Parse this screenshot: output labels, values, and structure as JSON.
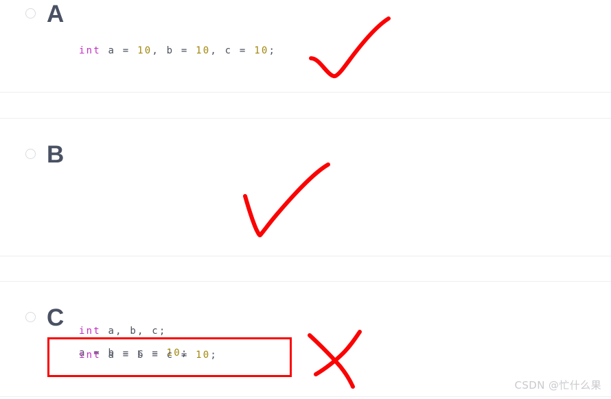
{
  "quiz": {
    "options": [
      {
        "letter": "A",
        "radio_state": "unselected",
        "code_lines": [
          [
            {
              "t": "int",
              "k": "kw"
            },
            {
              "t": " a ",
              "k": "id"
            },
            {
              "t": "=",
              "k": "op"
            },
            {
              "t": " ",
              "k": "punc"
            },
            {
              "t": "10",
              "k": "num"
            },
            {
              "t": ", b ",
              "k": "id"
            },
            {
              "t": "=",
              "k": "op"
            },
            {
              "t": " ",
              "k": "punc"
            },
            {
              "t": "10",
              "k": "num"
            },
            {
              "t": ", c ",
              "k": "id"
            },
            {
              "t": "=",
              "k": "op"
            },
            {
              "t": " ",
              "k": "punc"
            },
            {
              "t": "10",
              "k": "num"
            },
            {
              "t": ";",
              "k": "punc"
            }
          ]
        ],
        "code_text": "int a = 10, b = 10, c = 10;",
        "annotation": "check"
      },
      {
        "letter": "B",
        "radio_state": "unselected",
        "code_lines": [
          [
            {
              "t": "int",
              "k": "kw"
            },
            {
              "t": " a, b, c;",
              "k": "id"
            }
          ],
          [
            {
              "t": "a ",
              "k": "id"
            },
            {
              "t": "=",
              "k": "op"
            },
            {
              "t": " b ",
              "k": "id"
            },
            {
              "t": "=",
              "k": "op"
            },
            {
              "t": " c ",
              "k": "id"
            },
            {
              "t": "=",
              "k": "op"
            },
            {
              "t": " ",
              "k": "punc"
            },
            {
              "t": "10",
              "k": "num"
            },
            {
              "t": ";",
              "k": "punc"
            }
          ]
        ],
        "code_text": "int a, b, c;\na = b = c = 10;",
        "annotation": "check"
      },
      {
        "letter": "C",
        "radio_state": "unselected",
        "code_lines": [
          [
            {
              "t": "int",
              "k": "kw"
            },
            {
              "t": " a ",
              "k": "id"
            },
            {
              "t": "=",
              "k": "op"
            },
            {
              "t": " b ",
              "k": "id"
            },
            {
              "t": "=",
              "k": "op"
            },
            {
              "t": " c ",
              "k": "id"
            },
            {
              "t": "=",
              "k": "op"
            },
            {
              "t": " ",
              "k": "punc"
            },
            {
              "t": "10",
              "k": "num"
            },
            {
              "t": ";",
              "k": "punc"
            }
          ]
        ],
        "code_text": "int a = b = c = 10;",
        "annotation": "cross",
        "highlight_box": true
      }
    ]
  },
  "annotations": {
    "check_a": "red-handdrawn-checkmark",
    "check_b": "red-handdrawn-checkmark",
    "cross_c": "red-handdrawn-cross",
    "box_c": "red-rectangle-highlight"
  },
  "colors": {
    "annotation_red": "#fb0303",
    "keyword": "#c42ec4",
    "number": "#a1860d",
    "identifier": "#4a4f5c",
    "letter": "#4a5163",
    "divider": "#eceef1",
    "radio_border": "#d9dbe0",
    "watermark": "#c9cacd"
  },
  "watermark": {
    "text": "CSDN @忙什么果"
  }
}
